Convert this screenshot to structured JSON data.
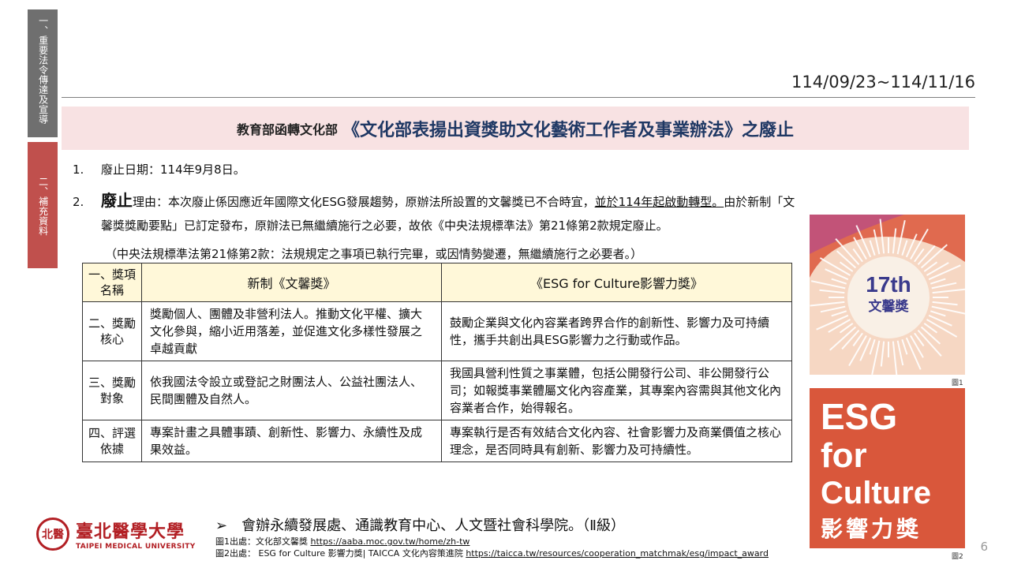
{
  "sidebar": {
    "tab1": "一、重要法令傳達及宣導",
    "tab2": "二、補充資料"
  },
  "date_range": "114/09/23~114/11/16",
  "title": {
    "prefix": "教育部函轉文化部",
    "main": "《文化部表揚出資獎助文化藝術工作者及事業辦法》之廢止"
  },
  "items": {
    "i1_num": "1.",
    "i1_text": "廢止日期：114年9月8日。",
    "i2_num": "2.",
    "i2_big": "廢止",
    "i2_pre": "理由：本次廢止係因應近年國際文化ESG發展趨勢，原辦法所設置的文馨獎已不合時宜，",
    "i2_underlined": "並於114年起啟動轉型。",
    "i2_post": "由於新制「文",
    "i2_line2": "馨獎獎勵要點」已訂定發布，原辦法已無繼續施行之必要，故依《中央法規標準法》第21條第2款規定廢止。",
    "note": "（中央法規標準法第21條第2款：法規規定之事項已執行完畢，或因情勢變遷，無繼續施行之必要者。）"
  },
  "table": {
    "header": {
      "label": "一、獎項名稱",
      "col1": "新制《文馨獎》",
      "col2": "《ESG for Culture影響力獎》"
    },
    "rows": [
      {
        "label": "二、獎勵核心",
        "col1": "獎勵個人、團體及非營利法人。推動文化平權、擴大文化參與，縮小近用落差，並促進文化多樣性發展之卓越貢獻",
        "col2": "鼓勵企業與文化內容業者跨界合作的創新性、影響力及可持續性，攜手共創出具ESG影響力之行動或作品。"
      },
      {
        "label": "三、獎勵對象",
        "col1": "依我國法令設立或登記之財團法人、公益社團法人、民間團體及自然人。",
        "col2": "我國具營利性質之事業體，包括公開發行公司、非公開發行公司；如報獎事業體屬文化內容產業，其專案內容需與其他文化內容業者合作，始得報名。"
      },
      {
        "label": "四、評選依據",
        "col1": "專案計畫之具體事蹟、創新性、影響力、永續性及成果效益。",
        "col2": "專案執行是否有效結合文化內容、社會影響力及商業價值之核心理念，是否同時具有創新、影響力及可持續性。"
      }
    ]
  },
  "images": {
    "img1_text_top": "17th",
    "img1_text_bottom": "文馨獎",
    "img1_caption": "圖1",
    "img2_line1": "ESG",
    "img2_line2": "for",
    "img2_line3": "Culture",
    "img2_line4": "影響力獎",
    "img2_caption": "圖2"
  },
  "logo": {
    "seal": "北醫",
    "cn": "臺北醫學大學",
    "en": "TAIPEI MEDICAL UNIVERSITY"
  },
  "organizer": "➢　會辦永續發展處、通識教育中心、人文暨社會科學院。（Ⅱ級）",
  "sources": {
    "s1_label": "圖1出處：文化部文馨獎",
    "s1_url": "https://aaba.moc.gov.tw/home/zh-tw",
    "s2_label": "圖2出處： ESG for Culture 影響力獎| TAICCA 文化內容策進院",
    "s2_url": "https://taicca.tw/resources/cooperation_matchmak/esg/impact_award"
  },
  "page_number": "6",
  "colors": {
    "accent_red": "#c0504d",
    "title_navy": "#1f3864",
    "title_bg": "#f8e2e3",
    "header_bg": "#fff8d9",
    "img2_bg": "#d9573b"
  }
}
